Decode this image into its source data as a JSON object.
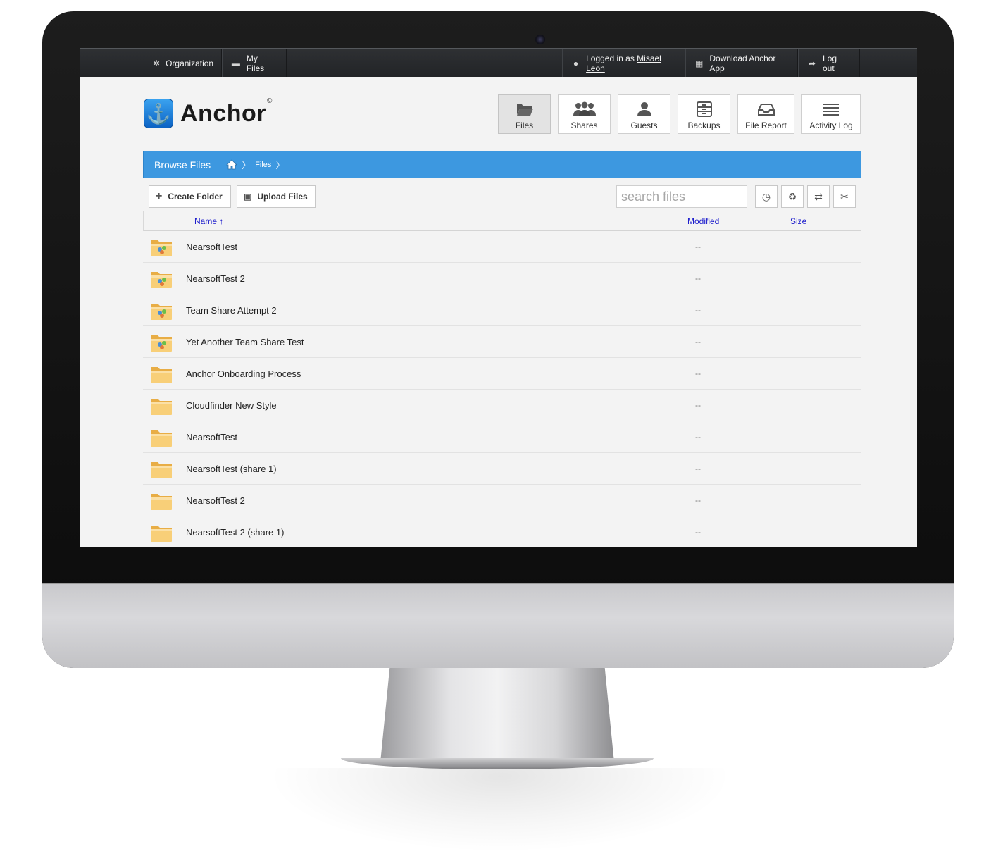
{
  "topbar": {
    "organization": "Organization",
    "my_files": "My Files",
    "logged_in_prefix": "Logged in as",
    "user_name": "Misael Leon",
    "download": "Download Anchor App",
    "logout": "Log out"
  },
  "brand": {
    "name": "Anchor",
    "mark": "©"
  },
  "nav": {
    "files": "Files",
    "shares": "Shares",
    "guests": "Guests",
    "backups": "Backups",
    "file_report": "File Report",
    "activity_log": "Activity Log"
  },
  "browse": {
    "title": "Browse Files",
    "crumb": "Files"
  },
  "toolbar": {
    "create_folder": "Create Folder",
    "upload_files": "Upload Files",
    "search_placeholder": "search files"
  },
  "columns": {
    "name": "Name ↑",
    "modified": "Modified",
    "size": "Size"
  },
  "files": [
    {
      "name": "NearsoftTest",
      "modified": "--",
      "shared": true
    },
    {
      "name": "NearsoftTest 2",
      "modified": "--",
      "shared": true
    },
    {
      "name": "Team Share Attempt 2",
      "modified": "--",
      "shared": true
    },
    {
      "name": "Yet Another Team Share Test",
      "modified": "--",
      "shared": true
    },
    {
      "name": "Anchor Onboarding Process",
      "modified": "--",
      "shared": false
    },
    {
      "name": "Cloudfinder New Style",
      "modified": "--",
      "shared": false
    },
    {
      "name": "NearsoftTest",
      "modified": "--",
      "shared": false
    },
    {
      "name": "NearsoftTest (share 1)",
      "modified": "--",
      "shared": false
    },
    {
      "name": "NearsoftTest 2",
      "modified": "--",
      "shared": false
    },
    {
      "name": "NearsoftTest 2 (share 1)",
      "modified": "--",
      "shared": false
    }
  ],
  "colors": {
    "accent": "#3d98e0",
    "topbar": "#26282b",
    "folder": "#f6c86a"
  }
}
